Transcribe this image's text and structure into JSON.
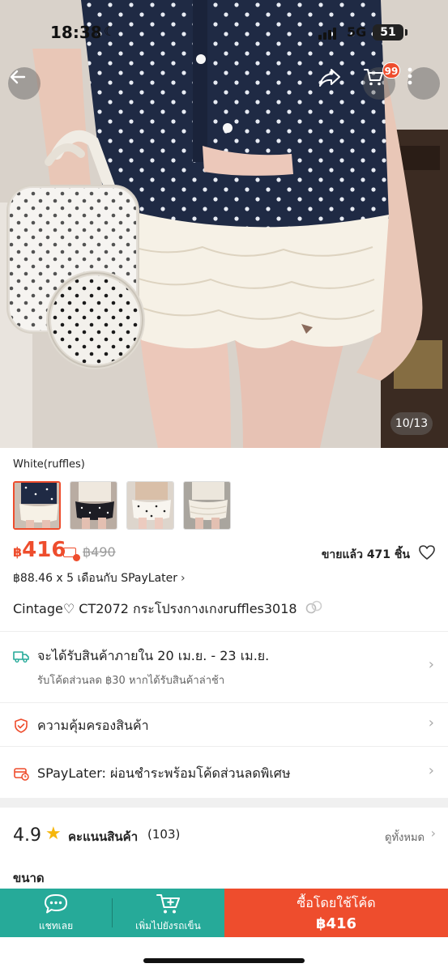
{
  "status_bar": {
    "time": "18:38",
    "network": "5G",
    "battery": "51"
  },
  "header": {
    "cart_badge": "99",
    "image_counter": "10/13"
  },
  "variants": {
    "selected_name": "White(ruffles)",
    "thumbnails": [
      "white-ruffles",
      "black-dots",
      "white-dots",
      "cream"
    ]
  },
  "price": {
    "currency": "฿",
    "current": "416",
    "original": "฿490",
    "sold": "ขายแล้ว 471 ชิ้น"
  },
  "installment": {
    "text": "฿88.46 x 5 เดือนกับ SPayLater",
    "chevron": "›"
  },
  "product": {
    "title": "Cintage♡ CT2072 กระโปรงกางเกงruffles3018"
  },
  "delivery": {
    "label": "จะได้รับสินค้าภายใน 20 เม.ย. - 23 เม.ย.",
    "sub": "รับโค้ดส่วนลด ฿30 หากได้รับสินค้าล่าช้า"
  },
  "protection": {
    "label": "ความคุ้มครองสินค้า"
  },
  "spaylater": {
    "label": "SPayLater: ผ่อนชำระพร้อมโค้ดส่วนลดพิเศษ"
  },
  "rating": {
    "score": "4.9",
    "label": "คะแนนสินค้า",
    "count": "(103)",
    "view_all": "ดูทั้งหมด"
  },
  "size_section": {
    "label": "ขนาด"
  },
  "bottom_bar": {
    "chat_label": "แชทเลย",
    "cart_label": "เพิ่มไปยังรถเข็น",
    "buy_label": "ซื้อโดยใช้โค้ด",
    "buy_price": "฿416"
  },
  "colors": {
    "brand": "#ee4d2d",
    "teal": "#26aa99"
  }
}
